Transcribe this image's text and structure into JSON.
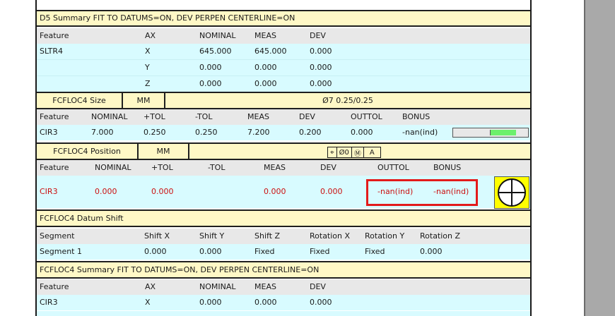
{
  "d5": {
    "header": "D5 Summary  FIT TO DATUMS=ON,  DEV PERPEN CENTERLINE=ON",
    "columns": [
      "Feature",
      "AX",
      "NOMINAL",
      "MEAS",
      "DEV"
    ],
    "rows": [
      [
        "SLTR4",
        "X",
        "645.000",
        "645.000",
        "0.000"
      ],
      [
        "",
        "Y",
        "0.000",
        "0.000",
        "0.000"
      ],
      [
        "",
        "Z",
        "0.000",
        "0.000",
        "0.000"
      ]
    ]
  },
  "size": {
    "title": "FCFLOC4 Size",
    "unit": "MM",
    "tolerance": "Ø7  0.25/0.25",
    "columns": [
      "Feature",
      "NOMINAL",
      "+TOL",
      "-TOL",
      "MEAS",
      "DEV",
      "OUTTOL",
      "BONUS"
    ],
    "row": [
      "CIR3",
      "7.000",
      "0.250",
      "0.250",
      "7.200",
      "0.200",
      "0.000",
      "-nan(ind)"
    ],
    "gauge_fill": 0.35
  },
  "position": {
    "title": "FCFLOC4 Position",
    "unit": "MM",
    "frame": [
      "Ø0",
      "A"
    ],
    "columns": [
      "Feature",
      "NOMINAL",
      "+TOL",
      "-TOL",
      "MEAS",
      "DEV",
      "OUTTOL",
      "BONUS"
    ],
    "row": [
      "CIR3",
      "0.000",
      "0.000",
      "",
      "0.000",
      "0.000",
      "-nan(ind)",
      "-nan(ind)"
    ],
    "colors": {
      "fail": "#cc1111",
      "highlight": "#e31b1b",
      "target_bg": "#ffff00"
    }
  },
  "datum_shift": {
    "header": "FCFLOC4 Datum Shift",
    "columns": [
      "Segment",
      "Shift X",
      "Shift Y",
      "Shift Z",
      "Rotation X",
      "Rotation Y",
      "Rotation Z"
    ],
    "row": [
      "Segment 1",
      "0.000",
      "0.000",
      "Fixed",
      "Fixed",
      "Fixed",
      "0.000"
    ]
  },
  "summary": {
    "header": "FCFLOC4 Summary  FIT TO DATUMS=ON,  DEV PERPEN CENTERLINE=ON",
    "columns": [
      "Feature",
      "AX",
      "NOMINAL",
      "MEAS",
      "DEV"
    ],
    "rows": [
      [
        "CIR3",
        "X",
        "0.000",
        "0.000",
        "0.000"
      ]
    ]
  },
  "colors": {
    "header_bg": "#fff8c6",
    "colhdr_bg": "#e8e8e8",
    "data_bg": "#d8fbff",
    "gauge_green": "#6cf06c"
  }
}
